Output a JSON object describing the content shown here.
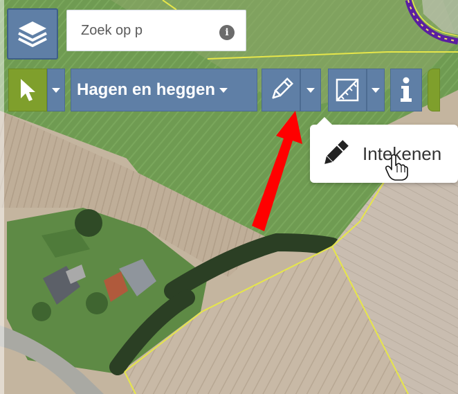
{
  "search": {
    "placeholder": "Zoek op p"
  },
  "toolbar": {
    "select_tool": "select-arrow-icon",
    "layer_dropdown_label": "Hagen en heggen",
    "draw_tool": "pencil-icon",
    "measure_tool": "ruler-square-icon",
    "info_tool": "info-icon"
  },
  "dropdown": {
    "items": [
      {
        "label": "Intekenen",
        "icon": "pencil-icon"
      }
    ]
  },
  "colors": {
    "toolbar_blue": "#5f7fa6",
    "toolbar_green": "#7f9f2c",
    "parcel_line": "#e6e64a",
    "annotation_arrow": "#ff0000",
    "protected_area_purple": "#5a1fa0"
  }
}
